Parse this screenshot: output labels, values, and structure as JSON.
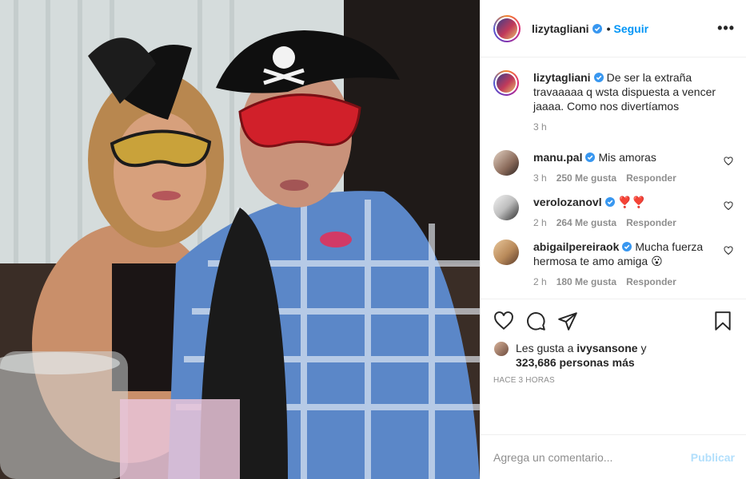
{
  "post": {
    "author": "lizytagliani",
    "follow_separator": "•",
    "follow_label": "Seguir",
    "more_label": "•••"
  },
  "caption": {
    "user": "lizytagliani",
    "text": "De ser la extraña travaaaaa q wsta dispuesta a vencer jaaaa. Como nos divertíamos",
    "time": "3 h"
  },
  "comments": [
    {
      "user": "manu.pal",
      "text": "Mis amoras",
      "time": "3 h",
      "likes": "250 Me gusta",
      "reply": "Responder"
    },
    {
      "user": "verolozanovl",
      "text": "❣️❣️",
      "time": "2 h",
      "likes": "264 Me gusta",
      "reply": "Responder"
    },
    {
      "user": "abigailpereiraok",
      "text": "Mucha fuerza hermosa te amo amiga 😮",
      "time": "2 h",
      "likes": "180 Me gusta",
      "reply": "Responder"
    }
  ],
  "likes": {
    "prefix": "Les gusta a",
    "liker": "ivysansone",
    "conjunction": "y",
    "count": "323,686 personas más"
  },
  "timestamp": "Hace 3 horas",
  "composer": {
    "placeholder": "Agrega un comentario...",
    "publish_label": "Publicar"
  },
  "colors": {
    "link": "#0095f6",
    "publish_disabled": "#b2dffc",
    "verified": "#3897f0",
    "muted": "#8e8e8e"
  },
  "icons": [
    "verified-badge-icon",
    "heart-icon",
    "comment-icon",
    "share-icon",
    "bookmark-icon",
    "more-options-icon"
  ]
}
